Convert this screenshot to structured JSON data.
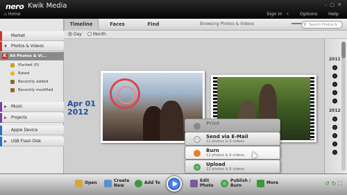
{
  "app": {
    "logo": "nero",
    "name": "Kwik Media",
    "home": "Home"
  },
  "window_controls": [
    "–",
    "□",
    "✕"
  ],
  "top_menu": {
    "sign_in": "Sign In",
    "options": "Options",
    "help": "Help"
  },
  "sidebar": {
    "market": "Market",
    "photos_videos": "Photos & Videos",
    "all_photos": "All Photos & Vi...",
    "all_count": "(10361)",
    "sub_items": [
      "Marked (0)",
      "Rated",
      "Recently added",
      "Recently modified"
    ],
    "music": "Music",
    "projects": "Projects",
    "apple_device": "Apple Device",
    "usb": "USB Flash Disk"
  },
  "tabs": [
    "Timeline",
    "Faces",
    "Find"
  ],
  "breadcrumb": "Browsing Photos & Videos",
  "search_placeholder": "Search Photos & Video",
  "view_modes": {
    "day": "Day",
    "month": "Month"
  },
  "content": {
    "date_line1": "Apr 01",
    "date_line2": "2012"
  },
  "timeline_years": [
    "2011",
    "2012"
  ],
  "context_menu": [
    {
      "title": "Print",
      "sub": ""
    },
    {
      "title": "Send via E-Mail",
      "sub": "12 photos & 9 videos"
    },
    {
      "title": "Burn",
      "sub": "12 photos & 9 videos"
    },
    {
      "title": "Upload",
      "sub": "12 photos & 9 videos"
    }
  ],
  "toolbar": {
    "open": "Open",
    "create_new_1": "Create",
    "create_new_2": "New",
    "add_to": "Add To",
    "edit_photo_1": "Edit",
    "edit_photo_2": "Photo",
    "publish_1": "Publish /",
    "publish_2": "Burn",
    "more": "More"
  },
  "colors": {
    "accent_red": "#c0392b",
    "date_blue": "#1d4e9a"
  }
}
